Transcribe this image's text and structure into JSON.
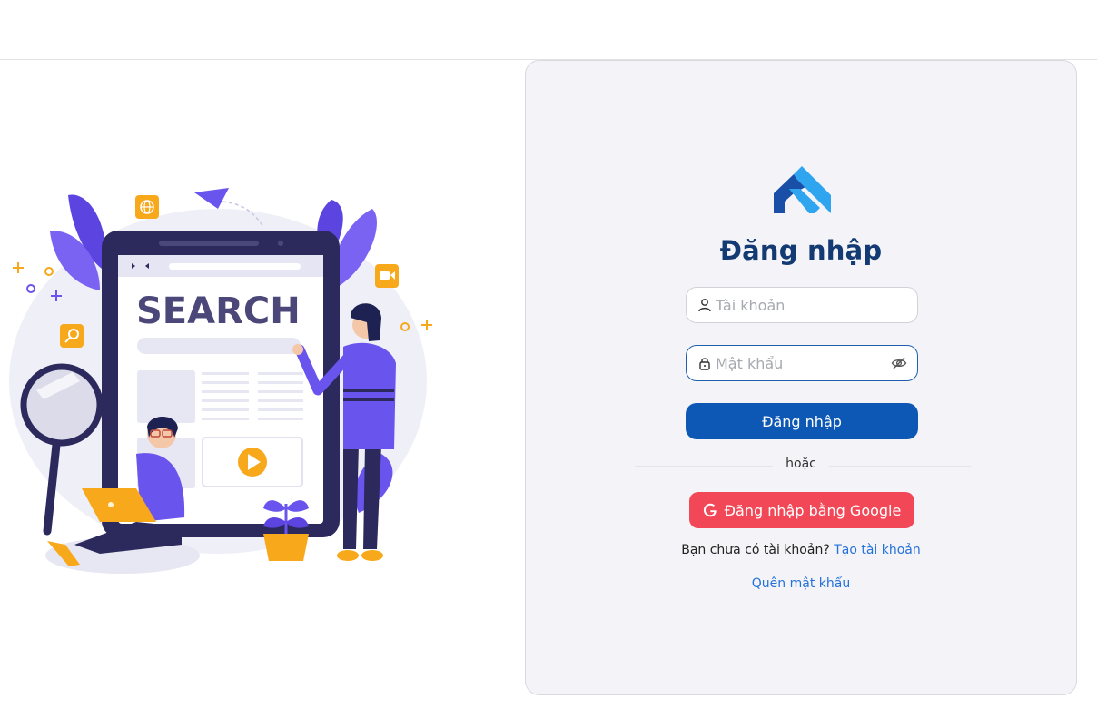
{
  "login": {
    "title": "Đăng nhập",
    "username_placeholder": "Tài khoản",
    "password_placeholder": "Mật khẩu",
    "submit_label": "Đăng nhập",
    "or_label": "hoặc",
    "google_label": "Đăng nhập bằng Google",
    "signup_prompt": "Bạn chưa có tài khoản?",
    "signup_link": "Tạo tài khoản",
    "forgot_link": "Quên mật khẩu"
  },
  "illustration": {
    "search_text": "SEARCH"
  },
  "colors": {
    "primary": "#0e58b5",
    "title": "#133a72",
    "google": "#f24756",
    "link": "#2472d9",
    "accent_purple": "#5b4ff0",
    "accent_orange": "#f7a81b"
  },
  "icons": [
    "logo-icon",
    "user-icon",
    "lock-icon",
    "eye-off-icon",
    "google-icon",
    "globe-icon",
    "video-icon",
    "search-icon",
    "paper-plane-icon",
    "play-icon"
  ]
}
